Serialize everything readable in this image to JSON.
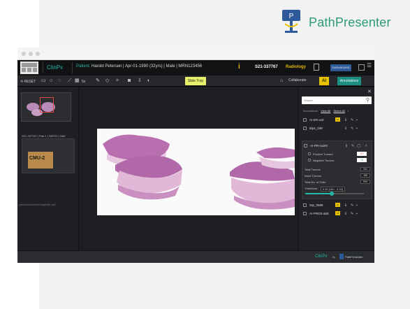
{
  "brand": {
    "name": "PathPresenter",
    "logo_icon": "microscope-logo-icon"
  },
  "app": {
    "name": "ClinPx",
    "logo_text": "LOGO TEXT HERE",
    "patient_label": "Patient:",
    "patient_details": "Harold Petersen | Apr-01-1990 (32yrs) | Male | MRN123456",
    "case_number": "S21-337767",
    "department": "Radiology",
    "dashboard_label": "DASHBOARD"
  },
  "toolbar": {
    "reset_label": "RESET",
    "zoom_label": "5x",
    "slide_tray_label": "Slide Tray",
    "collaborate_label": "Collaborate",
    "ai_label": "AI",
    "annotations_label": "Annotations"
  },
  "left_panel": {
    "slide_id": "S21-337767 | Part 1 | DEF23 | H&E",
    "slide_label": "CMU-2",
    "footer_note": "paths/to/slide/label/image/file.ndpi"
  },
  "annotations": {
    "search_placeholder": "Search",
    "header_label": "Annotations",
    "view_all": "View All",
    "select_all": "Select All",
    "items": [
      {
        "name": "AI-ER-xx0"
      },
      {
        "name": "Elps_038"
      },
      {
        "name": "AI-PR-run#2"
      },
      {
        "name": "Sqr_0596"
      },
      {
        "name": "AI-PROS-ab0"
      }
    ],
    "expanded": {
      "positive_label": "Positive Tumors",
      "positive_value": "177",
      "negative_label": "Negative Tumors",
      "negative_value": "74",
      "total_tumors_label": "Total Tumors",
      "total_tumors_value": "341",
      "none_tumors_label": "None Tumors",
      "none_tumors_value": "168",
      "total_cells_label": "Total No. of Cells",
      "total_cells_value": "509",
      "threshold_label": "Threshold",
      "threshold_value": "0.40 (Min : 0.33)",
      "threshold_level": 0.45
    }
  },
  "footer": {
    "clinpx": "ClinPx",
    "by": "by",
    "pathpresenter": "PathPresenter"
  },
  "colors": {
    "accent": "#26b8a6",
    "brand_green": "#2e9a7a",
    "ai_yellow": "#e6c200",
    "dashboard_blue": "#2f5a9a"
  }
}
